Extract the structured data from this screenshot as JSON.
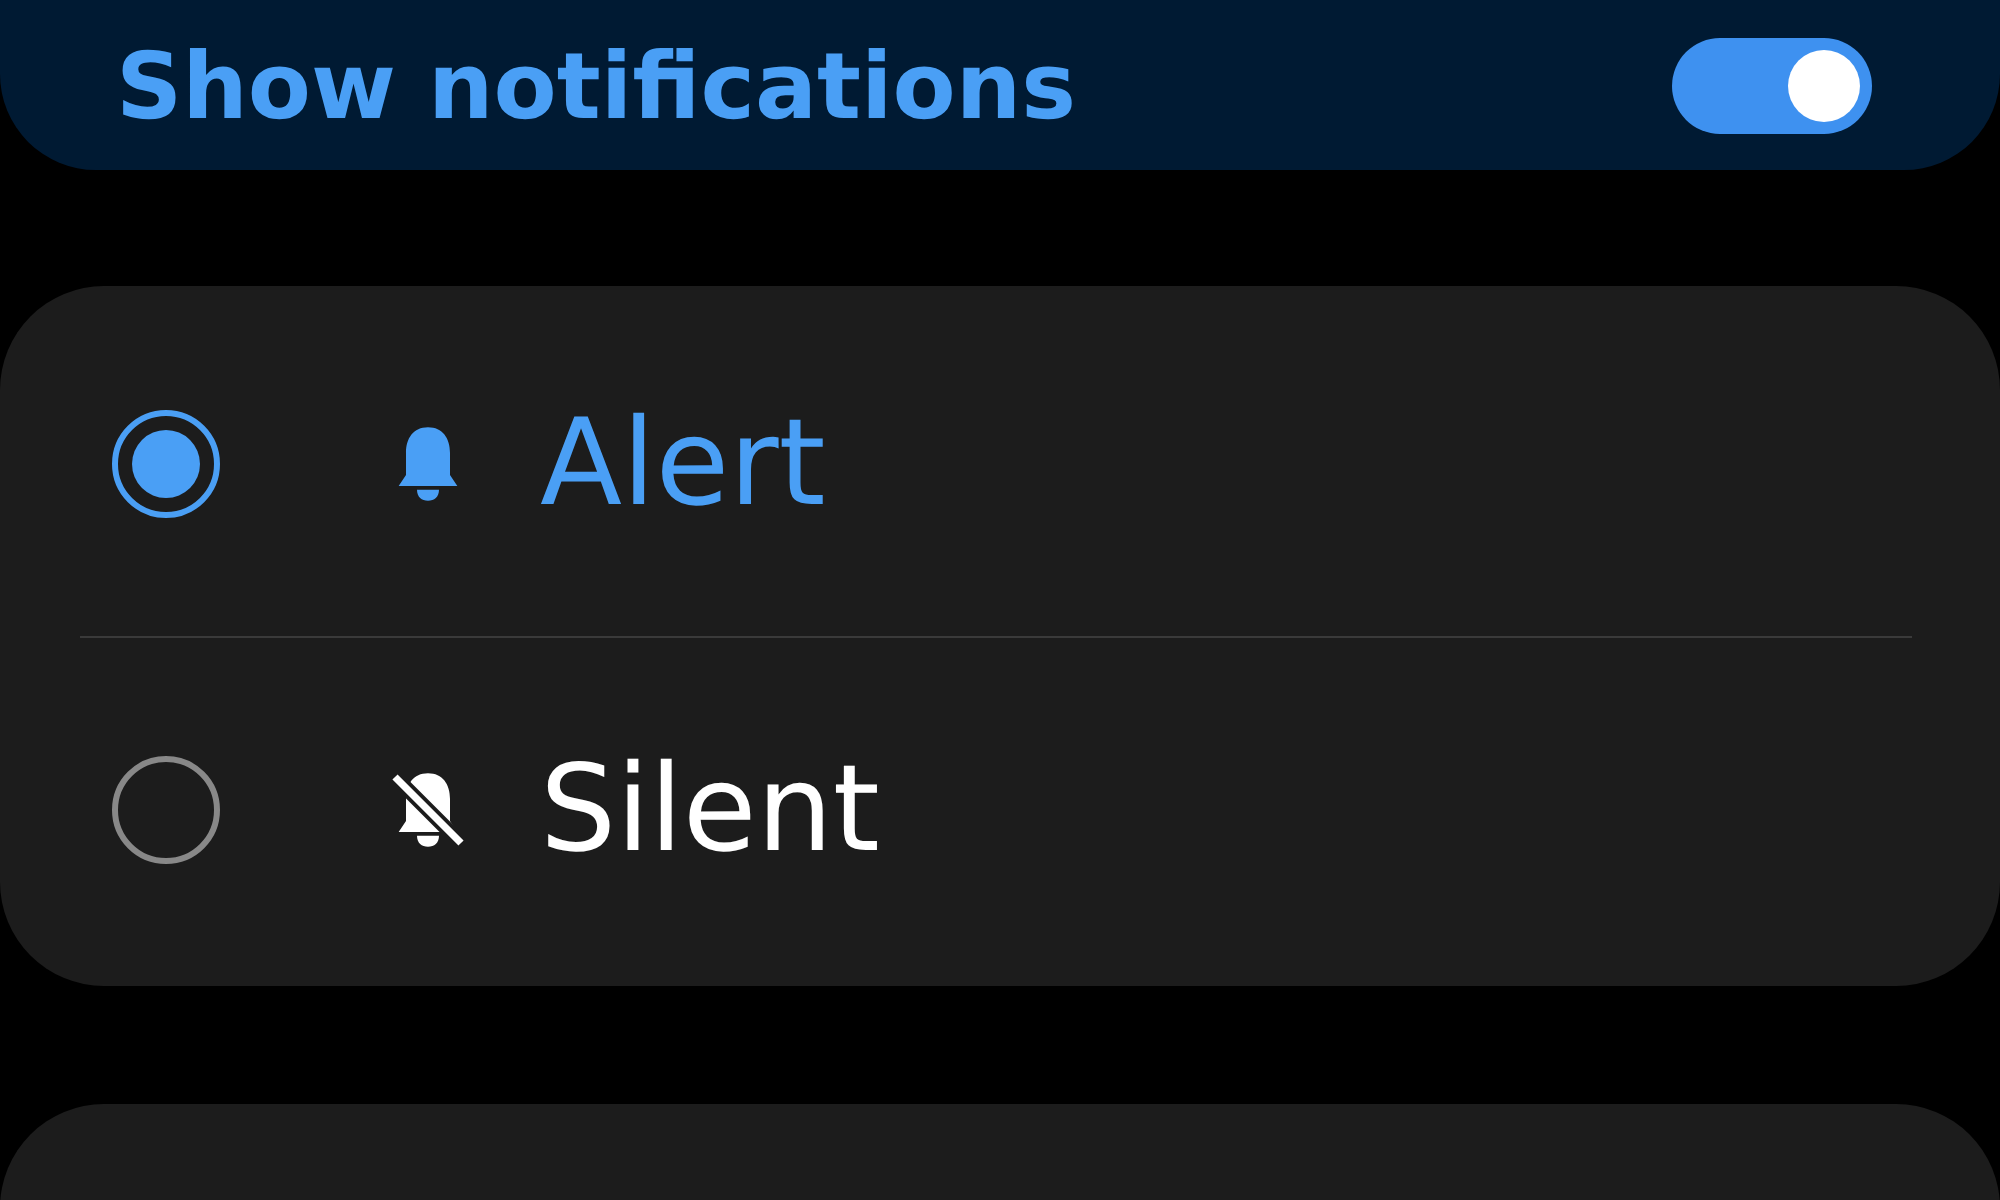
{
  "notifications": {
    "label": "Show notifications",
    "on": true
  },
  "options": [
    {
      "kind": "alert",
      "label": "Alert",
      "selected": true
    },
    {
      "kind": "silent",
      "label": "Silent",
      "selected": false
    }
  ]
}
